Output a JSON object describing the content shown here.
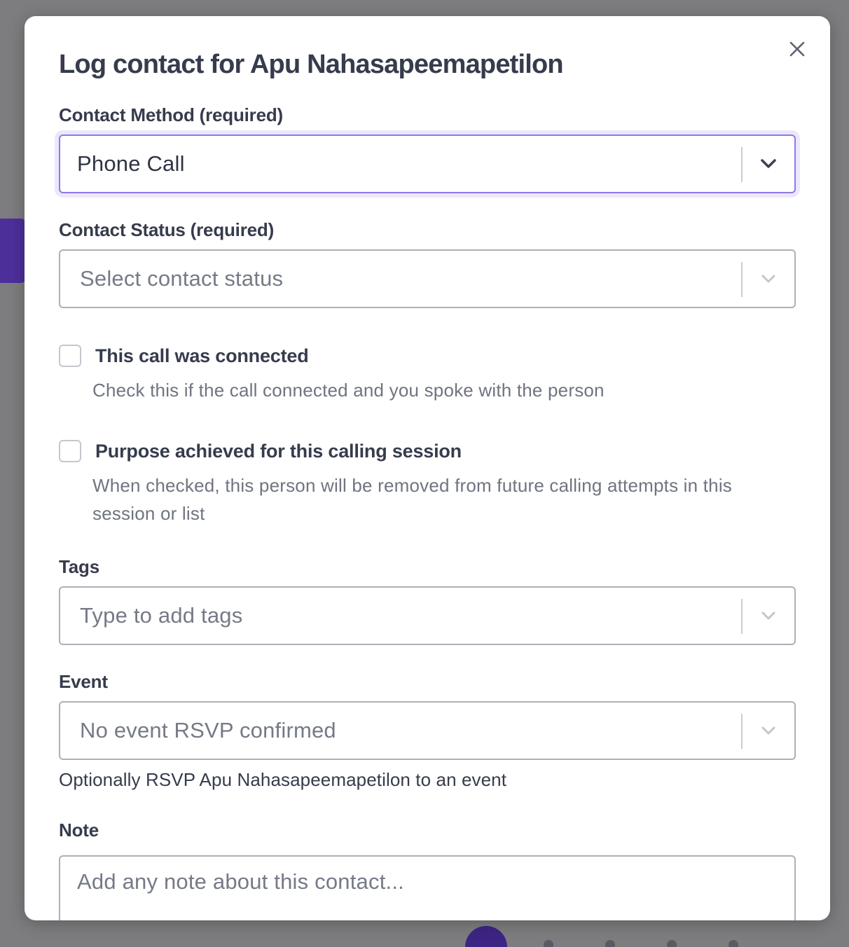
{
  "dialog": {
    "title": "Log contact for Apu Nahasapeemapetilon",
    "close_icon": "close-icon"
  },
  "contact_method": {
    "label": "Contact Method (required)",
    "selected": "Phone Call"
  },
  "contact_status": {
    "label": "Contact Status (required)",
    "placeholder": "Select contact status"
  },
  "call_connected": {
    "label": "This call was connected",
    "help": "Check this if the call connected and you spoke with the person",
    "checked": false
  },
  "purpose_achieved": {
    "label": "Purpose achieved for this calling session",
    "help": "When checked, this person will be removed from future calling attempts in this session or list",
    "checked": false
  },
  "tags": {
    "label": "Tags",
    "placeholder": "Type to add tags"
  },
  "event": {
    "label": "Event",
    "placeholder": "No event RSVP confirmed",
    "help": "Optionally RSVP Apu Nahasapeemapetilon to an event"
  },
  "note": {
    "label": "Note",
    "placeholder": "Add any note about this contact..."
  },
  "colors": {
    "focus_border": "#8f78e6",
    "focus_ring": "#ece7fc",
    "text_dark": "#363c4c",
    "text_muted": "#757a86"
  }
}
